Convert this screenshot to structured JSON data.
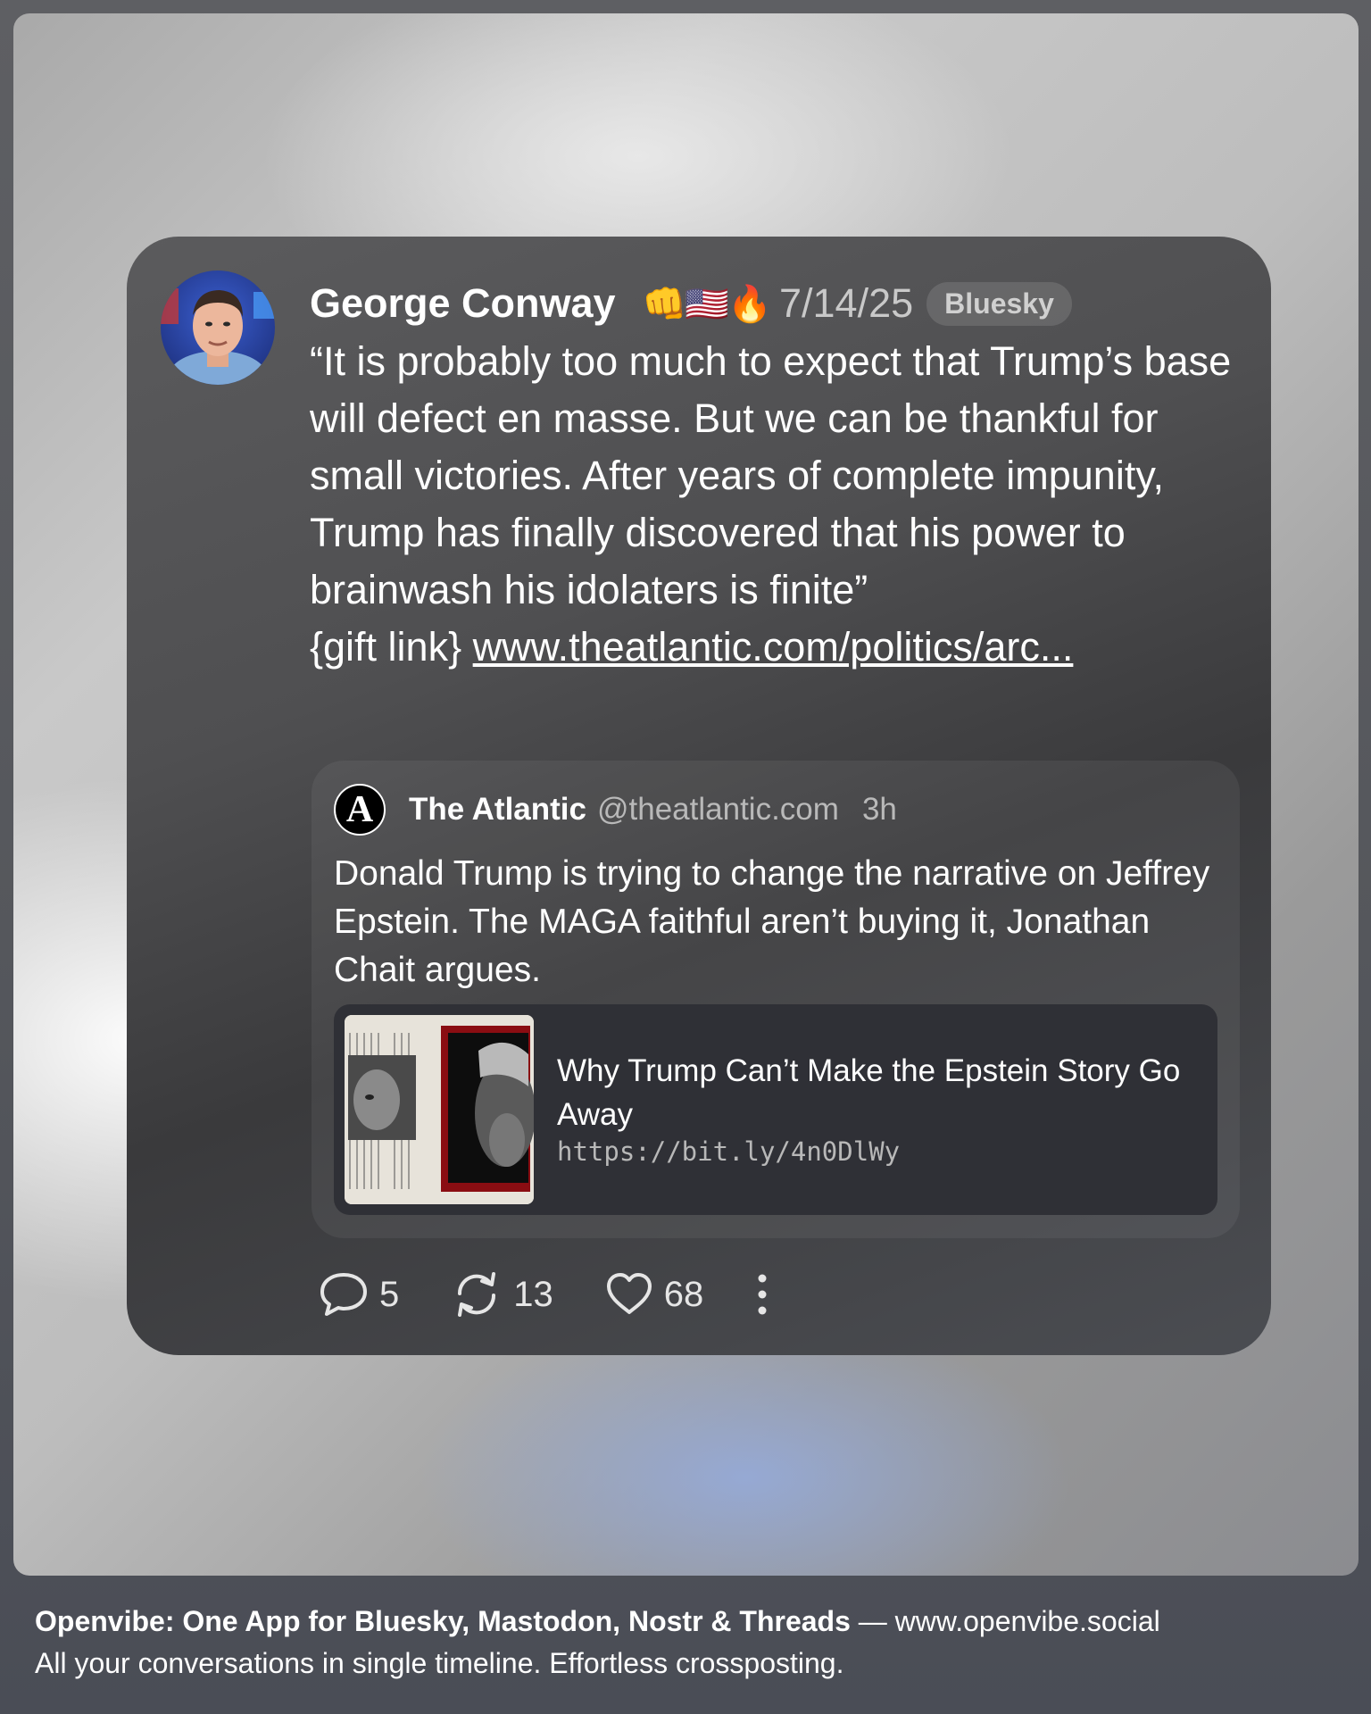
{
  "post": {
    "author": "George Conway",
    "emojis": "👊🇺🇸🔥",
    "date": "7/14/25",
    "network": "Bluesky",
    "text": "“It is probably too much to expect that Trump’s base will defect en masse. But we can be thankful for small victories. After years of complete impunity, Trump has finally discovered that his power to brainwash his idolaters is finite”",
    "link_prefix": "{gift link}",
    "link_text": "www.theatlantic.com/politics/arc...",
    "avatar_icon": "user-photo-icon"
  },
  "quote": {
    "avatar_letter": "A",
    "name": "The Atlantic",
    "handle": "@theatlantic.com",
    "time": "3h",
    "text": "Donald Trump is trying to change the narrative on Jeffrey Epstein. The MAGA faithful aren’t buying it, Jonathan Chait argues.",
    "link_card": {
      "title": "Why Trump Can’t Make the Epstein Story Go Away",
      "url": "https://bit.ly/4n0DlWy"
    }
  },
  "actions": {
    "replies": "5",
    "reposts": "13",
    "likes": "68"
  },
  "footer": {
    "brand": "Openvibe: One App for Bluesky, Mastodon, Nostr & Threads",
    "site": " — www.openvibe.social",
    "tagline": "All your conversations in single timeline. Effortless crossposting."
  },
  "colors": {
    "card_background": "#4a4a4c",
    "quote_background": "#55565a",
    "link_card_background": "#2f3036",
    "muted_text": "#b9b9b9"
  }
}
